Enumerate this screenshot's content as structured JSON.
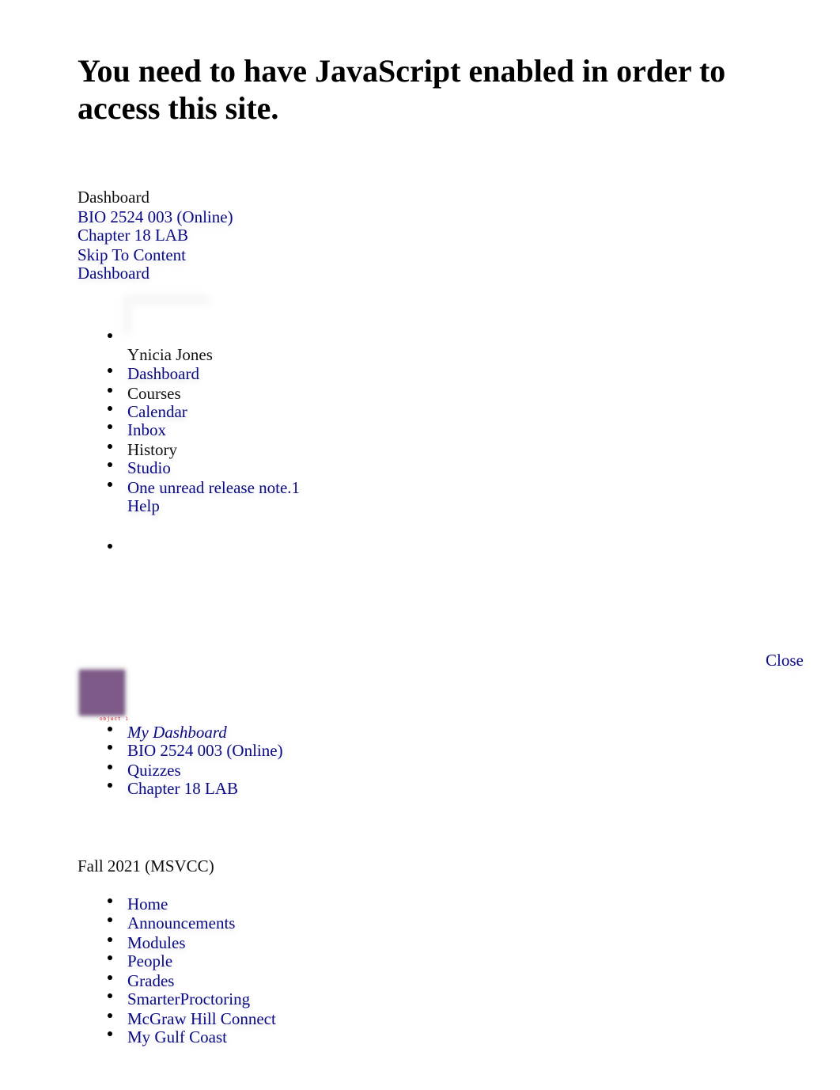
{
  "noscript_message": "You need to have JavaScript enabled in order to access this site.",
  "top_links": {
    "dashboard_label": "Dashboard",
    "course_link": "BIO 2524 003 (Online)",
    "assignment_link": "Chapter 18 LAB",
    "skip_link": "Skip To Content",
    "dashboard_link": "Dashboard"
  },
  "global_nav": {
    "user_name": "Ynicia Jones",
    "items": [
      {
        "label": "Dashboard",
        "is_link": true
      },
      {
        "label": "Courses",
        "is_link": false
      },
      {
        "label": "Calendar",
        "is_link": true
      },
      {
        "label": "Inbox",
        "is_link": true
      },
      {
        "label": "History",
        "is_link": false
      },
      {
        "label": "Studio",
        "is_link": true
      },
      {
        "label": "One unread release note.1",
        "is_link": true
      }
    ],
    "help_label": "Help"
  },
  "close_label": "Close",
  "avatar": {
    "icon": "user-avatar-icon",
    "overlay_label": "object 1"
  },
  "breadcrumbs": [
    {
      "label": "My Dashboard",
      "italic": true
    },
    {
      "label": "BIO 2524 003 (Online)",
      "italic": false
    },
    {
      "label": "Quizzes",
      "italic": false
    },
    {
      "label": "Chapter 18 LAB",
      "italic": false
    }
  ],
  "term_label": "Fall 2021 (MSVCC)",
  "course_nav": [
    "Home",
    "Announcements",
    "Modules",
    "People",
    "Grades",
    "SmarterProctoring",
    "McGraw Hill Connect",
    "My Gulf Coast"
  ],
  "colors": {
    "link": "#0a0a85",
    "text": "#111111",
    "heading": "#000000",
    "avatar": "#7e5a88",
    "object_label": "#e02020"
  }
}
